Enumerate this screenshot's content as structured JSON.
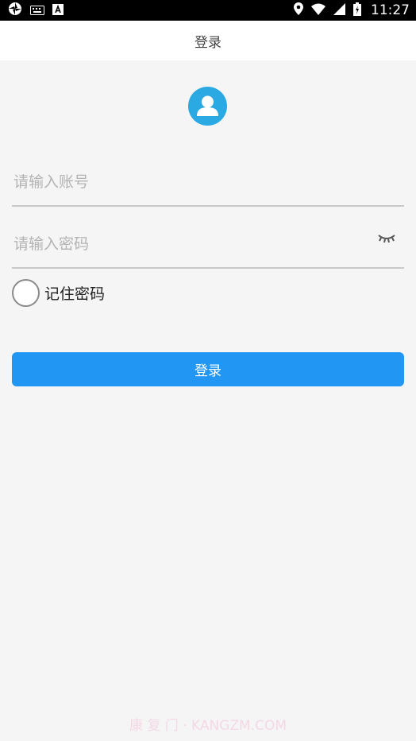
{
  "status_bar": {
    "time": "11:27",
    "left_icons": [
      "aperture-icon",
      "keyboard-icon",
      "font-a-icon"
    ],
    "right_icons": [
      "location-pin-icon",
      "wifi-icon",
      "cell-signal-icon",
      "battery-charging-icon"
    ]
  },
  "app_bar": {
    "title": "登录"
  },
  "form": {
    "account_placeholder": "请输入账号",
    "password_placeholder": "请输入密码",
    "remember_label": "记住密码",
    "remember_checked": false,
    "login_label": "登录"
  },
  "watermark": "康 复 门 · KANGZM.COM",
  "colors": {
    "primary": "#2196f3",
    "avatar": "#2aa9e3",
    "background": "#f5f5f5",
    "divider": "#c9c9c9"
  }
}
